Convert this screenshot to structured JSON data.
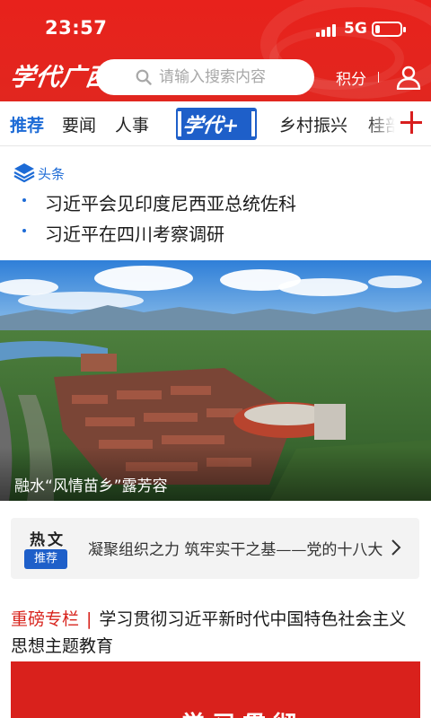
{
  "status": {
    "time": "23:57",
    "network": "5G",
    "battery_level": 0.2
  },
  "header": {
    "logo_text": "学代广西",
    "search_placeholder": "请输入搜索内容",
    "points_label": "积分",
    "accent_color": "#e8221c"
  },
  "tabs": {
    "items": [
      "推荐",
      "要闻",
      "人事",
      "乡村振兴",
      "桂部"
    ],
    "active": "推荐",
    "brand_label": "学代+"
  },
  "headlines": {
    "label": "头条",
    "items": [
      "习近平会见印度尼西亚总统佐科",
      "习近平在四川考察调研"
    ]
  },
  "banner": {
    "caption": "融水“风情苗乡”露芳容"
  },
  "hot": {
    "title": "热文",
    "tag": "推荐",
    "text": "凝聚组织之力   筑牢实干之基——党的十八大"
  },
  "column": {
    "tag": "重磅专栏",
    "separator": "|",
    "title": "学习贯彻习近平新时代中国特色社会主义思想主题教育",
    "card_peek": "学习贯彻"
  }
}
